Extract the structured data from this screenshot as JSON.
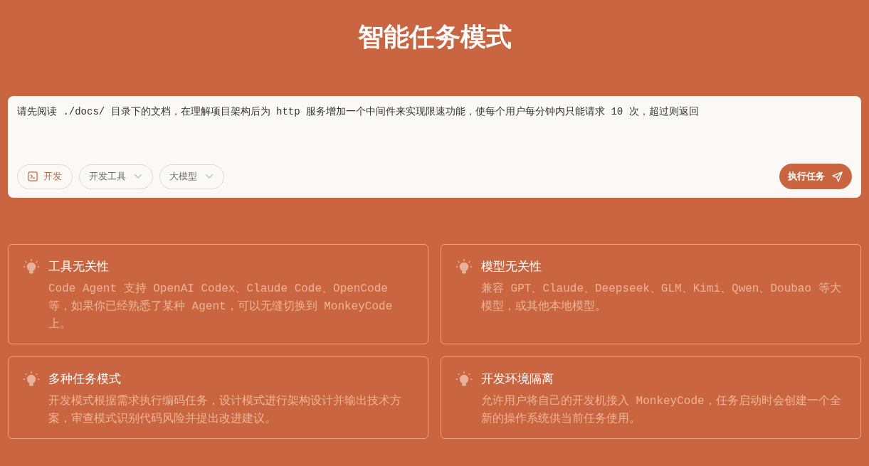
{
  "title": "智能任务模式",
  "task_input": {
    "value": "请先阅读 ./docs/ 目录下的文档，在理解项目架构后为 http 服务增加一个中间件来实现限速功能，使每个用户每分钟内只能请求 10 次，超过则返回"
  },
  "toolbar": [
    {
      "kind": "mode",
      "label": "开发",
      "active": true
    },
    {
      "kind": "dropdown",
      "label": "开发工具"
    },
    {
      "kind": "dropdown",
      "label": "大模型"
    }
  ],
  "submit_button": {
    "label": "执行任务"
  },
  "features": [
    {
      "title": "工具无关性",
      "description": "Code Agent 支持 OpenAI Codex、Claude Code、OpenCode 等，如果你已经熟悉了某种 Agent，可以无缝切换到 MonkeyCode 上。"
    },
    {
      "title": "模型无关性",
      "description": "兼容 GPT、Claude、Deepseek、GLM、Kimi、Qwen、Doubao 等大模型，或其他本地模型。"
    },
    {
      "title": "多种任务模式",
      "description": "开发模式根据需求执行编码任务，设计模式进行架构设计并输出技术方案，审查模式识别代码风险并提出改进建议。"
    },
    {
      "title": "开发环境隔离",
      "description": "允许用户将自己的开发机接入 MonkeyCode，任务启动时会创建一个全新的操作系统供当前任务使用。"
    }
  ]
}
